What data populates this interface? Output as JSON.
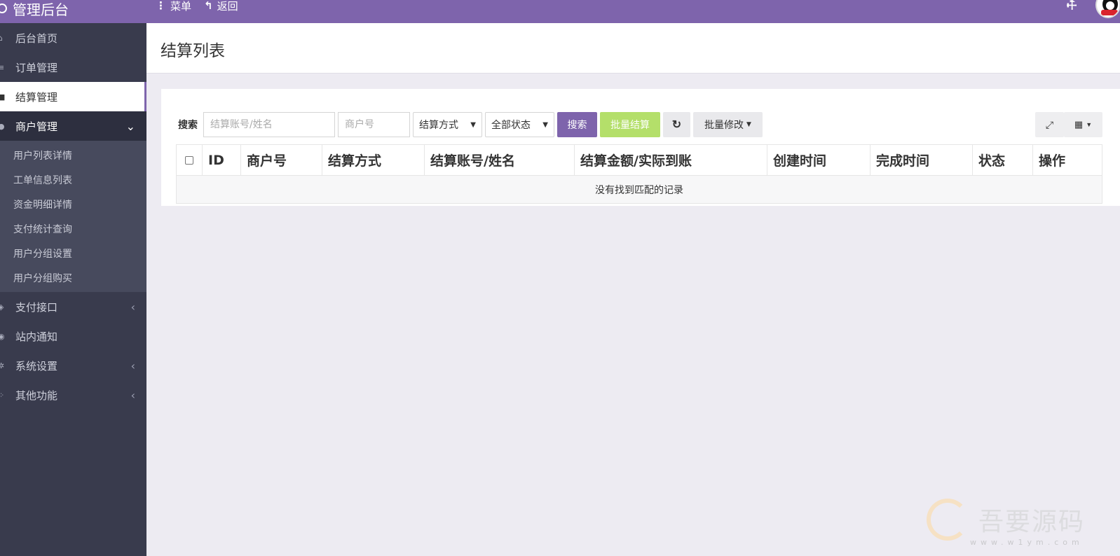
{
  "app": {
    "brand": "管理后台",
    "topnav": [
      {
        "icon": "ellipsis-v-icon",
        "label": "菜单"
      },
      {
        "icon": "reply-icon",
        "label": "返回"
      }
    ]
  },
  "sidebar": {
    "items": [
      {
        "label": "后台首页",
        "icon": "home-icon"
      },
      {
        "label": "订单管理",
        "icon": "list-icon"
      },
      {
        "label": "结算管理",
        "icon": "cart-icon",
        "active": true
      },
      {
        "label": "商户管理",
        "icon": "user-icon",
        "open": true
      }
    ],
    "submenu": [
      "用户列表详情",
      "工单信息列表",
      "资金明细详情",
      "支付统计查询",
      "用户分组设置",
      "用户分组购买"
    ],
    "items_after": [
      {
        "label": "支付接口",
        "icon": "cube-icon",
        "arrow": true
      },
      {
        "label": "站内通知",
        "icon": "bell-icon",
        "arrow": false
      },
      {
        "label": "系统设置",
        "icon": "gear-icon",
        "arrow": true
      },
      {
        "label": "其他功能",
        "icon": "cubes-icon",
        "arrow": true
      }
    ]
  },
  "header": {
    "title": "结算列表"
  },
  "toolbar": {
    "search_label": "搜索",
    "account_placeholder": "结算账号/姓名",
    "merchant_placeholder": "商户号",
    "method_select": "结算方式",
    "status_select": "全部状态",
    "search_button": "搜索",
    "batch_settle_button": "批量结算",
    "batch_edit_button": "批量修改"
  },
  "table": {
    "columns": [
      "ID",
      "商户号",
      "结算方式",
      "结算账号/姓名",
      "结算金额/实际到账",
      "创建时间",
      "完成时间",
      "状态",
      "操作"
    ],
    "empty_message": "没有找到匹配的记录"
  },
  "watermark": {
    "text": "吾要源码",
    "url": "www.w1ym.com"
  },
  "colors": {
    "accent": "#7e64ac",
    "success": "#b4df6a",
    "sidebar": "#393b4d"
  }
}
